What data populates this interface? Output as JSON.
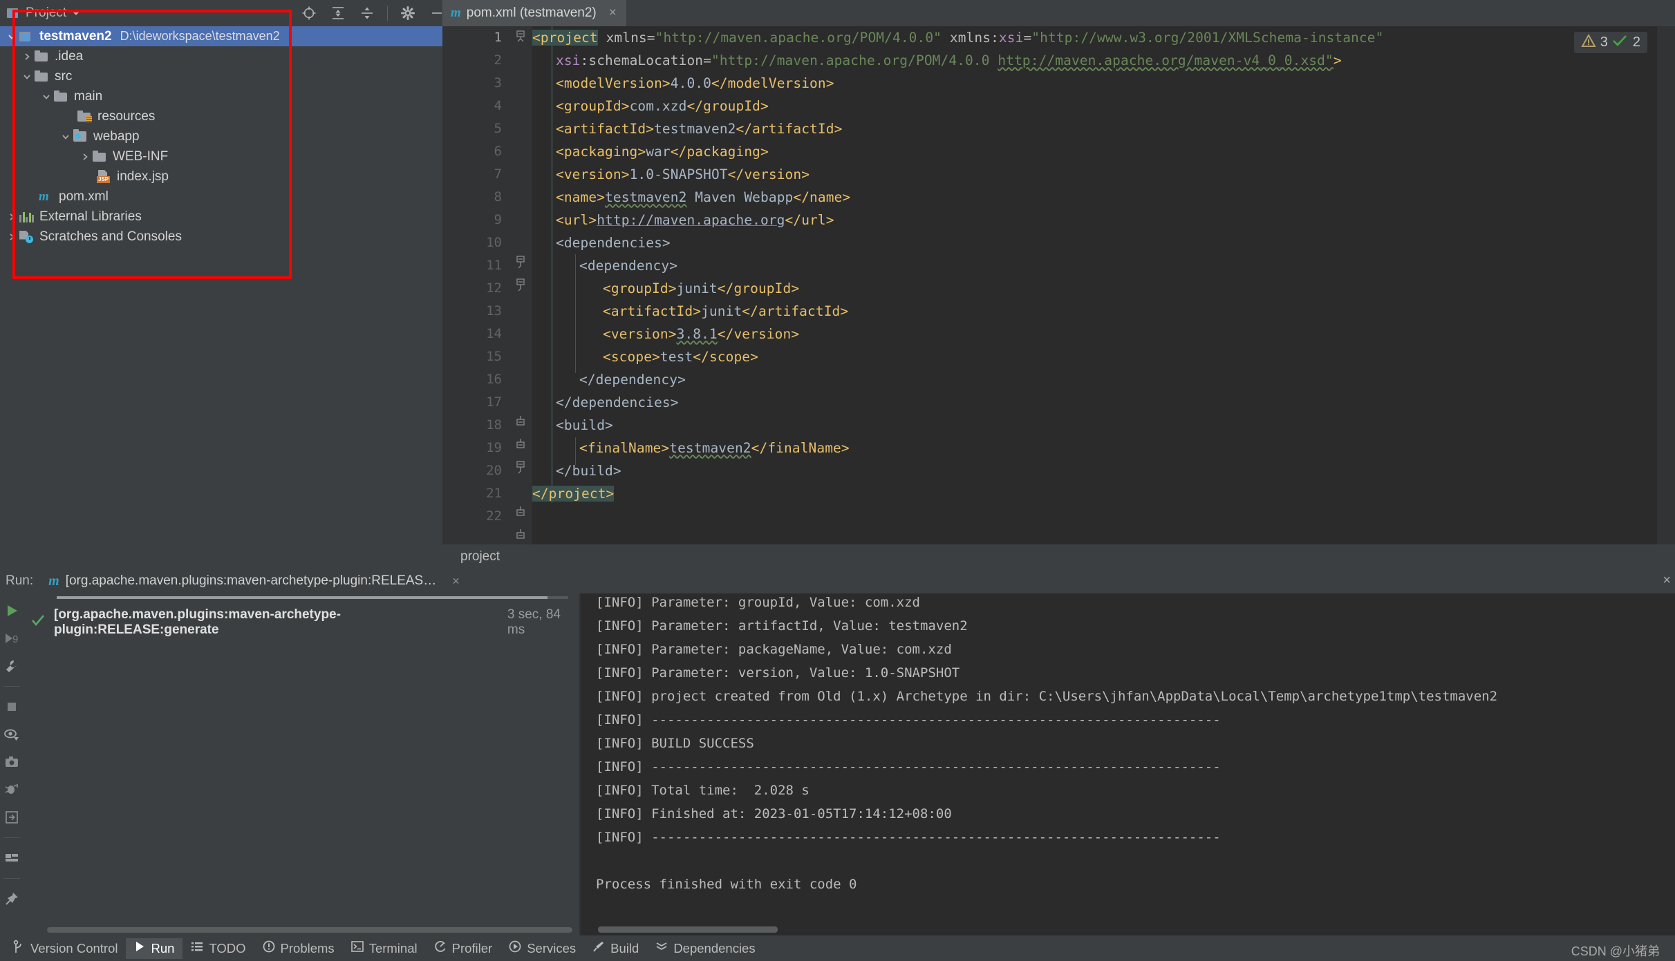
{
  "toolwindow": {
    "title": "Project",
    "icons": [
      "locate-icon",
      "expand-all-icon",
      "collapse-all-icon",
      "gear-icon",
      "minimize-icon"
    ]
  },
  "project_tree": [
    {
      "label": "testmaven2",
      "sub": "D:\\ideworkspace\\testmaven2",
      "icon": "project-module-icon",
      "depth": 0,
      "arrow": "down",
      "selected": true,
      "bold": true
    },
    {
      "label": ".idea",
      "sub": "",
      "icon": "folder-icon",
      "depth": 1,
      "arrow": "right",
      "selected": false,
      "bold": false
    },
    {
      "label": "src",
      "sub": "",
      "icon": "folder-icon",
      "depth": 1,
      "arrow": "down",
      "selected": false,
      "bold": false
    },
    {
      "label": "main",
      "sub": "",
      "icon": "folder-icon",
      "depth": 2,
      "arrow": "down",
      "selected": false,
      "bold": false
    },
    {
      "label": "resources",
      "sub": "",
      "icon": "resources-folder-icon",
      "depth": 3,
      "arrow": "none",
      "selected": false,
      "bold": false
    },
    {
      "label": "webapp",
      "sub": "",
      "icon": "webapp-folder-icon",
      "depth": 3,
      "arrow": "down",
      "selected": false,
      "bold": false
    },
    {
      "label": "WEB-INF",
      "sub": "",
      "icon": "folder-icon",
      "depth": 4,
      "arrow": "right",
      "selected": false,
      "bold": false
    },
    {
      "label": "index.jsp",
      "sub": "",
      "icon": "jsp-file-icon",
      "depth": 4,
      "arrow": "none",
      "selected": false,
      "bold": false
    },
    {
      "label": "pom.xml",
      "sub": "",
      "icon": "maven-file-icon",
      "depth": 2,
      "arrow": "none",
      "selected": false,
      "bold": false
    },
    {
      "label": "External Libraries",
      "sub": "",
      "icon": "libraries-icon",
      "depth": 0,
      "arrow": "right",
      "selected": false,
      "bold": false
    },
    {
      "label": "Scratches and Consoles",
      "sub": "",
      "icon": "scratches-icon",
      "depth": 0,
      "arrow": "right",
      "selected": false,
      "bold": false
    }
  ],
  "editor": {
    "tab_label": "pom.xml (testmaven2)",
    "tab_icon": "maven-file-icon",
    "tab_close": "×",
    "breadcrumb": "project",
    "inspections": {
      "warning_icon": "warning-triangle-icon",
      "warning_count": "3",
      "ok_icon": "check-mark-icon",
      "ok_count": "2"
    },
    "lines": [
      {
        "n": "1",
        "indent": 0,
        "fold": "open",
        "caret": true
      },
      {
        "n": "2",
        "indent": 0,
        "fold": "none"
      },
      {
        "n": "3",
        "indent": 0,
        "fold": "none"
      },
      {
        "n": "4",
        "indent": 0,
        "fold": "none"
      },
      {
        "n": "5",
        "indent": 0,
        "fold": "none"
      },
      {
        "n": "6",
        "indent": 0,
        "fold": "none"
      },
      {
        "n": "7",
        "indent": 0,
        "fold": "none"
      },
      {
        "n": "8",
        "indent": 0,
        "fold": "none"
      },
      {
        "n": "9",
        "indent": 0,
        "fold": "none"
      },
      {
        "n": "10",
        "indent": 0,
        "fold": "open"
      },
      {
        "n": "11",
        "indent": 0,
        "fold": "open"
      },
      {
        "n": "12",
        "indent": 0,
        "fold": "none"
      },
      {
        "n": "13",
        "indent": 0,
        "fold": "none"
      },
      {
        "n": "14",
        "indent": 0,
        "fold": "none"
      },
      {
        "n": "15",
        "indent": 0,
        "fold": "none"
      },
      {
        "n": "16",
        "indent": 0,
        "fold": "close"
      },
      {
        "n": "17",
        "indent": 0,
        "fold": "close"
      },
      {
        "n": "18",
        "indent": 0,
        "fold": "open"
      },
      {
        "n": "19",
        "indent": 0,
        "fold": "none"
      },
      {
        "n": "20",
        "indent": 0,
        "fold": "close"
      },
      {
        "n": "21",
        "indent": 0,
        "fold": "close"
      },
      {
        "n": "22",
        "indent": 0,
        "fold": "none"
      }
    ],
    "code_text": {
      "l1_tag": "<project",
      "l1_a1": " xmlns=",
      "l1_s1": "\"http://maven.apache.org/POM/4.0.0\"",
      "l1_a2": " xmlns:",
      "l1_ns": "xsi",
      "l1_eq": "=",
      "l1_s2": "\"http://www.w3.org/2001/XMLSchema-instance\"",
      "l2_ns": "xsi",
      "l2_rest": ":schemaLocation=",
      "l2_s1": "\"http://maven.apache.org/POM/4.0.0 ",
      "l2_s2": "http://maven.apache.org/maven-v4_0_0.xsd\"",
      "l2_gt": ">",
      "l3_o": "<modelVersion>",
      "l3_v": "4.0.0",
      "l3_c": "</modelVersion>",
      "l4_o": "<groupId>",
      "l4_v": "com.xzd",
      "l4_c": "</groupId>",
      "l5_o": "<artifactId>",
      "l5_v": "testmaven2",
      "l5_c": "</artifactId>",
      "l6_o": "<packaging>",
      "l6_v": "war",
      "l6_c": "</packaging>",
      "l7_o": "<version>",
      "l7_v": "1.0-SNAPSHOT",
      "l7_c": "</version>",
      "l8_o": "<name>",
      "l8_v1": "testmaven2",
      "l8_v2": " Maven Webapp",
      "l8_c": "</name>",
      "l9_o": "<url>",
      "l9_v": "http://maven.apache.org",
      "l9_c": "</url>",
      "l10": "<dependencies>",
      "l11": "<dependency>",
      "l12_o": "<groupId>",
      "l12_v": "junit",
      "l12_c": "</groupId>",
      "l13_o": "<artifactId>",
      "l13_v": "junit",
      "l13_c": "</artifactId>",
      "l14_o": "<version>",
      "l14_v": "3.8.1",
      "l14_c": "</version>",
      "l15_o": "<scope>",
      "l15_v": "test",
      "l15_c": "</scope>",
      "l16": "</dependency>",
      "l17": "</dependencies>",
      "l18": "<build>",
      "l19_o": "<finalName>",
      "l19_v": "testmaven2",
      "l19_c": "</finalName>",
      "l20": "</build>",
      "l21": "</project>"
    }
  },
  "run_panel": {
    "label": "Run:",
    "tab_title": "[org.apache.maven.plugins:maven-archetype-plugin:RELEAS…",
    "tab_icon": "maven-file-icon",
    "tab_close": "×",
    "panel_close": "×",
    "test_result": {
      "status_icon": "green-check-icon",
      "name": "[org.apache.maven.plugins:maven-archetype-plugin:RELEASE:generate",
      "duration": "3 sec, 84 ms"
    },
    "left_tools": [
      "rerun-icon",
      "rerun-failed-icon",
      "wrench-icon",
      "stop-icon",
      "eye-icon",
      "camera-icon",
      "bug-icon",
      "export-icon",
      "layout-icon",
      "pin-icon"
    ],
    "console_lines": [
      "[INFO] Parameter: groupId, Value: com.xzd",
      "[INFO] Parameter: artifactId, Value: testmaven2",
      "[INFO] Parameter: packageName, Value: com.xzd",
      "[INFO] Parameter: version, Value: 1.0-SNAPSHOT",
      "[INFO] project created from Old (1.x) Archetype in dir: C:\\Users\\jhfan\\AppData\\Local\\Temp\\archetype1tmp\\testmaven2",
      "[INFO] ------------------------------------------------------------------------",
      "[INFO] BUILD SUCCESS",
      "[INFO] ------------------------------------------------------------------------",
      "[INFO] Total time:  2.028 s",
      "[INFO] Finished at: 2023-01-05T17:14:12+08:00",
      "[INFO] ------------------------------------------------------------------------",
      "",
      "Process finished with exit code 0"
    ]
  },
  "statusbar": {
    "items": [
      {
        "label": "Version Control",
        "icon": "branch-icon",
        "active": false
      },
      {
        "label": "Run",
        "icon": "play-icon",
        "active": true
      },
      {
        "label": "TODO",
        "icon": "list-icon",
        "active": false
      },
      {
        "label": "Problems",
        "icon": "problems-icon",
        "active": false
      },
      {
        "label": "Terminal",
        "icon": "terminal-icon",
        "active": false
      },
      {
        "label": "Profiler",
        "icon": "profiler-icon",
        "active": false
      },
      {
        "label": "Services",
        "icon": "services-icon",
        "active": false
      },
      {
        "label": "Build",
        "icon": "build-hammer-icon",
        "active": false
      },
      {
        "label": "Dependencies",
        "icon": "dependencies-icon",
        "active": false
      }
    ],
    "watermark": "CSDN @小猪弟"
  },
  "colors": {
    "panel_bg": "#3c3f41",
    "editor_bg": "#2b2b2b",
    "selection_blue": "#4b6eaf",
    "annotation_red": "#ff0000",
    "tag_orange": "#e8bf6a",
    "string_green": "#6a8759",
    "ns_purple": "#b389c5",
    "text_gray": "#a9b7c6"
  }
}
